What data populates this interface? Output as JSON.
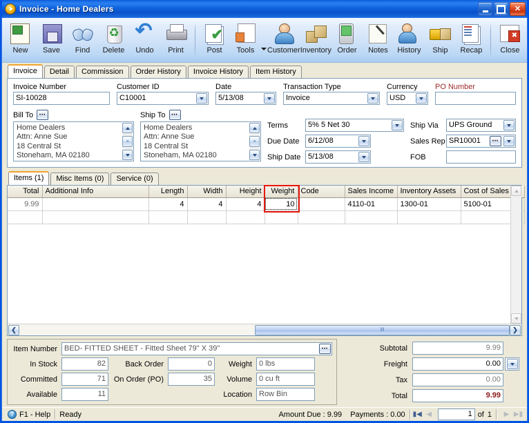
{
  "window": {
    "title": "Invoice - Home Dealers",
    "app_icon": "play-circle-icon",
    "controls": {
      "minimize": "Minimize",
      "maximize": "Maximize",
      "close": "Close"
    }
  },
  "toolbar": {
    "buttons": [
      {
        "label": "New",
        "icon": "new-document-icon"
      },
      {
        "label": "Save",
        "icon": "floppy-disk-icon"
      },
      {
        "label": "Find",
        "icon": "binoculars-icon"
      },
      {
        "label": "Delete",
        "icon": "recycle-bin-icon"
      },
      {
        "label": "Undo",
        "icon": "undo-arrow-icon"
      },
      {
        "label": "Print",
        "icon": "printer-icon"
      },
      {
        "label": "Post",
        "icon": "post-checkmark-icon"
      },
      {
        "label": "Tools",
        "icon": "tools-icon"
      },
      {
        "label": "Customer",
        "icon": "customer-person-icon"
      },
      {
        "label": "Inventory",
        "icon": "boxes-icon"
      },
      {
        "label": "Order",
        "icon": "order-device-icon"
      },
      {
        "label": "Notes",
        "icon": "notepad-pen-icon"
      },
      {
        "label": "History",
        "icon": "history-person-icon"
      },
      {
        "label": "Ship",
        "icon": "forklift-icon"
      },
      {
        "label": "Recap",
        "icon": "recap-pages-icon"
      },
      {
        "label": "Close",
        "icon": "close-window-icon"
      }
    ]
  },
  "tabs": {
    "items": [
      {
        "label": "Invoice",
        "active": true
      },
      {
        "label": "Detail",
        "active": false
      },
      {
        "label": "Commission",
        "active": false
      },
      {
        "label": "Order History",
        "active": false
      },
      {
        "label": "Invoice History",
        "active": false
      },
      {
        "label": "Item History",
        "active": false
      }
    ]
  },
  "form": {
    "invoice_number": {
      "label": "Invoice Number",
      "value": "SI-10028"
    },
    "customer_id": {
      "label": "Customer ID",
      "value": "C10001"
    },
    "date": {
      "label": "Date",
      "value": "5/13/08"
    },
    "transaction_type": {
      "label": "Transaction Type",
      "value": "Invoice"
    },
    "currency": {
      "label": "Currency",
      "value": "USD"
    },
    "po_number": {
      "label": "PO Number",
      "value": "",
      "required_color": "#9d2a2a"
    },
    "bill_to": {
      "label": "Bill To",
      "lines": [
        "Home Dealers",
        "Attn: Anne Sue",
        "18 Central St",
        "Stoneham, MA 02180"
      ]
    },
    "ship_to": {
      "label": "Ship To",
      "lines": [
        "Home Dealers",
        "Attn: Anne Sue",
        "18 Central St",
        "Stoneham, MA 02180"
      ]
    },
    "terms": {
      "label": "Terms",
      "value": "5% 5 Net 30"
    },
    "due_date": {
      "label": "Due Date",
      "value": "6/12/08"
    },
    "ship_date": {
      "label": "Ship Date",
      "value": "5/13/08"
    },
    "ship_via": {
      "label": "Ship Via",
      "value": "UPS Ground"
    },
    "sales_rep": {
      "label": "Sales Rep",
      "value": "SR10001"
    },
    "fob": {
      "label": "FOB",
      "value": ""
    }
  },
  "grid": {
    "tabs": [
      {
        "label": "Items (1)",
        "active": true
      },
      {
        "label": "Misc Items (0)",
        "active": false
      },
      {
        "label": "Service (0)",
        "active": false
      }
    ],
    "columns": [
      "Total",
      "Additional Info",
      "Length",
      "Width",
      "Height",
      "Weight",
      "Code",
      "Sales Income",
      "Inventory Assets",
      "Cost of Sales"
    ],
    "rows": [
      {
        "total": "9.99",
        "additional_info": "",
        "length": "4",
        "width": "4",
        "height": "4",
        "weight": "10",
        "code": "",
        "sales_income": "4110-01",
        "inventory_assets": "1300-01",
        "cost_of_sales": "5100-01"
      }
    ],
    "highlight": {
      "column": "Weight",
      "color": "#e8180c"
    }
  },
  "item_panel": {
    "item_number": {
      "label": "Item Number",
      "value": "BED- FITTED SHEET - Fitted Sheet 79\" X 39\""
    },
    "in_stock": {
      "label": "In Stock",
      "value": "82"
    },
    "committed": {
      "label": "Committed",
      "value": "71"
    },
    "available": {
      "label": "Available",
      "value": "11"
    },
    "back_order": {
      "label": "Back Order",
      "value": "0"
    },
    "on_order_po": {
      "label": "On Order (PO)",
      "value": "35"
    },
    "weight": {
      "label": "Weight",
      "value": "0 lbs"
    },
    "volume": {
      "label": "Volume",
      "value": "0 cu ft"
    },
    "location": {
      "label": "Location",
      "value": "Row  Bin"
    }
  },
  "totals": {
    "subtotal": {
      "label": "Subtotal",
      "value": "9.99"
    },
    "freight": {
      "label": "Freight",
      "value": "0.00",
      "flag": "N"
    },
    "tax": {
      "label": "Tax",
      "value": "0.00"
    },
    "total": {
      "label": "Total",
      "value": "9.99",
      "color": "#8b1a1a"
    }
  },
  "statusbar": {
    "help": "F1 - Help",
    "status": "Ready",
    "amount_due": "Amount Due : 9.99",
    "payments": "Payments : 0.00",
    "page_current": "1",
    "page_of": "of",
    "page_total": "1"
  }
}
